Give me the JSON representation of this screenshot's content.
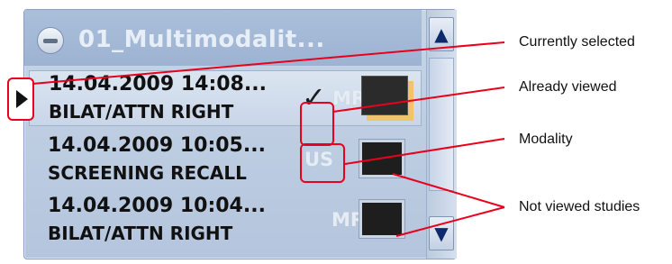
{
  "group": {
    "title": "01_Multimodalit..."
  },
  "studies": [
    {
      "date": "14.04.2009 14:08...",
      "description": "BILAT/ATTN RIGHT",
      "modality": "MR",
      "viewed": true,
      "selected": true,
      "check_glyph": "✓"
    },
    {
      "date": "14.04.2009 10:05...",
      "description": "SCREENING RECALL",
      "modality": "US",
      "viewed": false,
      "selected": false
    },
    {
      "date": "14.04.2009 10:04...",
      "description": "BILAT/ATTN RIGHT",
      "modality": "MR",
      "viewed": false,
      "selected": false
    }
  ],
  "scrollbar": {
    "up_glyph": "▲",
    "down_glyph": "▼"
  },
  "annotations": {
    "currently_selected": "Currently selected",
    "already_viewed": "Already viewed",
    "modality": "Modality",
    "not_viewed": "Not viewed studies"
  },
  "colors": {
    "annotation": "#e8001c",
    "panel": "#c7d5e6",
    "header": "#a3b8d5"
  },
  "icons": [
    "minus-circle-icon",
    "check-icon",
    "folder-thumbnail-icon",
    "image-thumbnail-icon",
    "scroll-up-icon",
    "scroll-down-icon",
    "pointer-icon"
  ]
}
